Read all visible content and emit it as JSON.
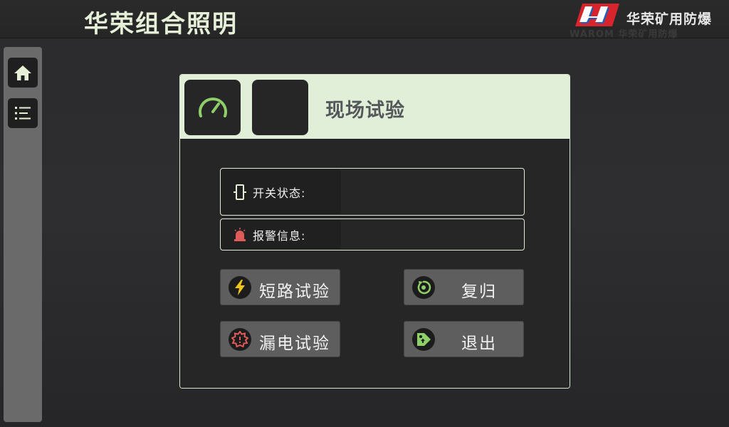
{
  "header": {
    "title": "华荣组合照明",
    "company": "华荣矿用防爆",
    "logo_icon": "warom-logo",
    "logo_ghost": "WAROM 华荣矿用防爆"
  },
  "sidebar": {
    "items": [
      {
        "icon": "home-icon"
      },
      {
        "icon": "list-icon"
      }
    ]
  },
  "panel": {
    "title": "现场试验",
    "header_icons": [
      "speedometer-icon",
      "blank-icon"
    ],
    "switch_status": {
      "label": "开关状态:",
      "value": ""
    },
    "alarm_info": {
      "label": "报警信息:",
      "value": ""
    }
  },
  "actions": {
    "short_circuit_test": "短路试验",
    "reset": "复归",
    "leakage_test": "漏电试验",
    "exit": "退出"
  },
  "colors": {
    "accent_green": "#8fcf6a",
    "header_bg": "#e2efd8",
    "alarm_red": "#e05a5a",
    "bolt_yellow": "#f0c419"
  }
}
